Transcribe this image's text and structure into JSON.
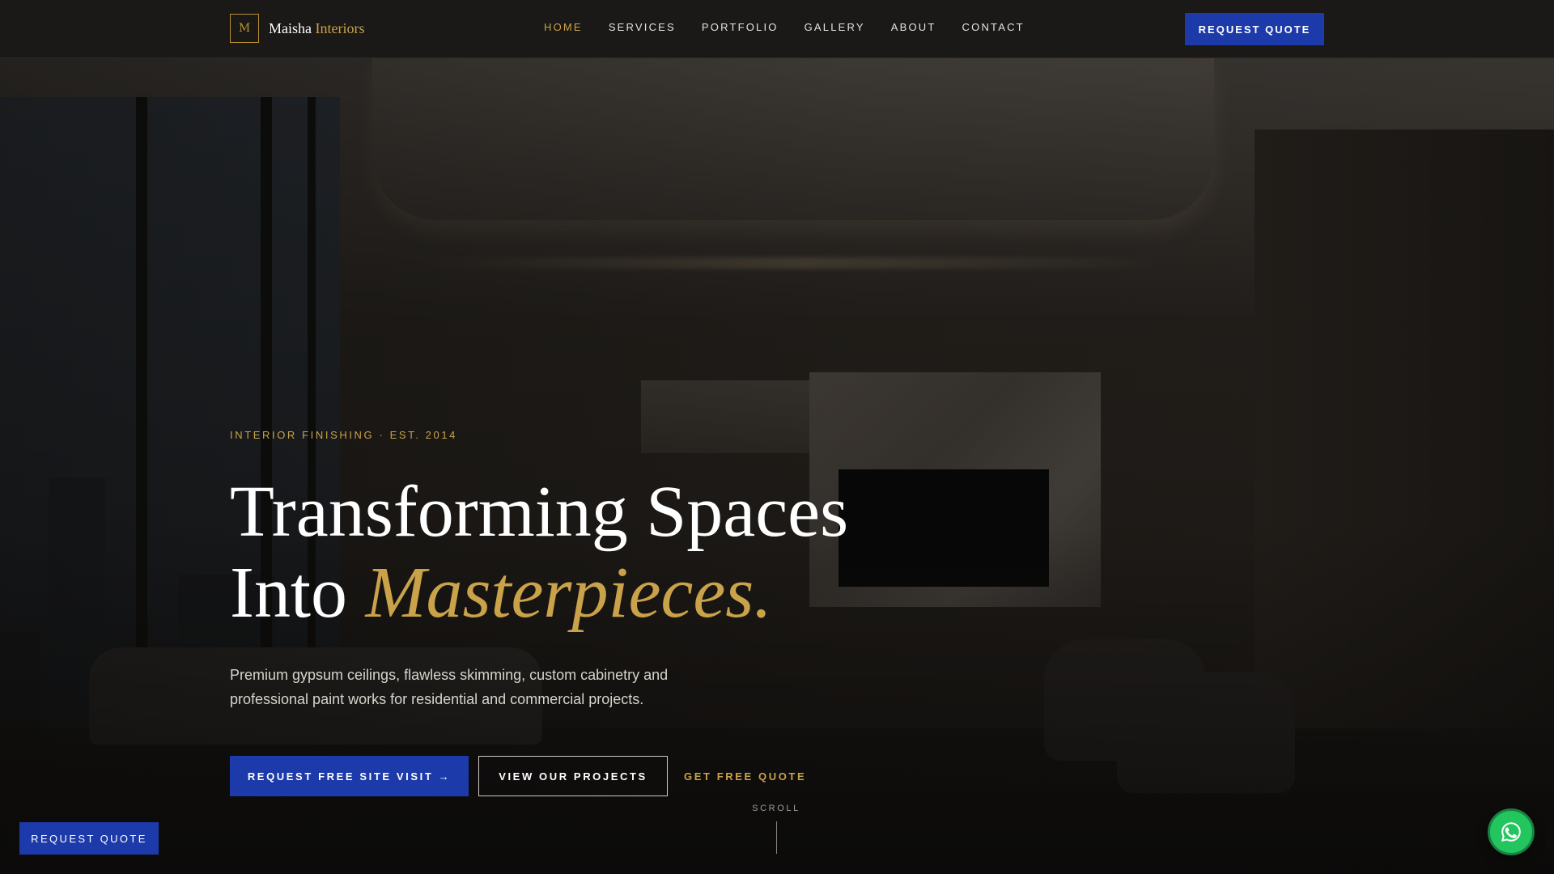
{
  "brand": {
    "mark": "M",
    "name": "Maisha",
    "accent": "Interiors",
    "accent_color": "#c9a24a",
    "primary_color": "#1c3aa9"
  },
  "nav": {
    "items": [
      {
        "label": "HOME",
        "active": true
      },
      {
        "label": "SERVICES",
        "active": false
      },
      {
        "label": "PORTFOLIO",
        "active": false
      },
      {
        "label": "GALLERY",
        "active": false
      },
      {
        "label": "ABOUT",
        "active": false
      },
      {
        "label": "CONTACT",
        "active": false
      }
    ],
    "cta": "REQUEST QUOTE"
  },
  "hero": {
    "eyebrow": "INTERIOR FINISHING · EST. 2014",
    "headline_line1": "Transforming Spaces",
    "headline_line2_prefix": "Into ",
    "headline_line2_accent": "Masterpieces.",
    "subtitle": "Premium gypsum ceilings, flawless skimming, custom cabinetry and professional paint works for residential and commercial projects.",
    "primary_cta": "REQUEST FREE SITE VISIT →",
    "secondary_cta": "VIEW OUR PROJECTS",
    "link_cta": "GET FREE QUOTE",
    "scroll_label": "SCROLL"
  },
  "floating": {
    "quote_button": "REQUEST QUOTE",
    "whatsapp_icon": "whatsapp-icon"
  }
}
